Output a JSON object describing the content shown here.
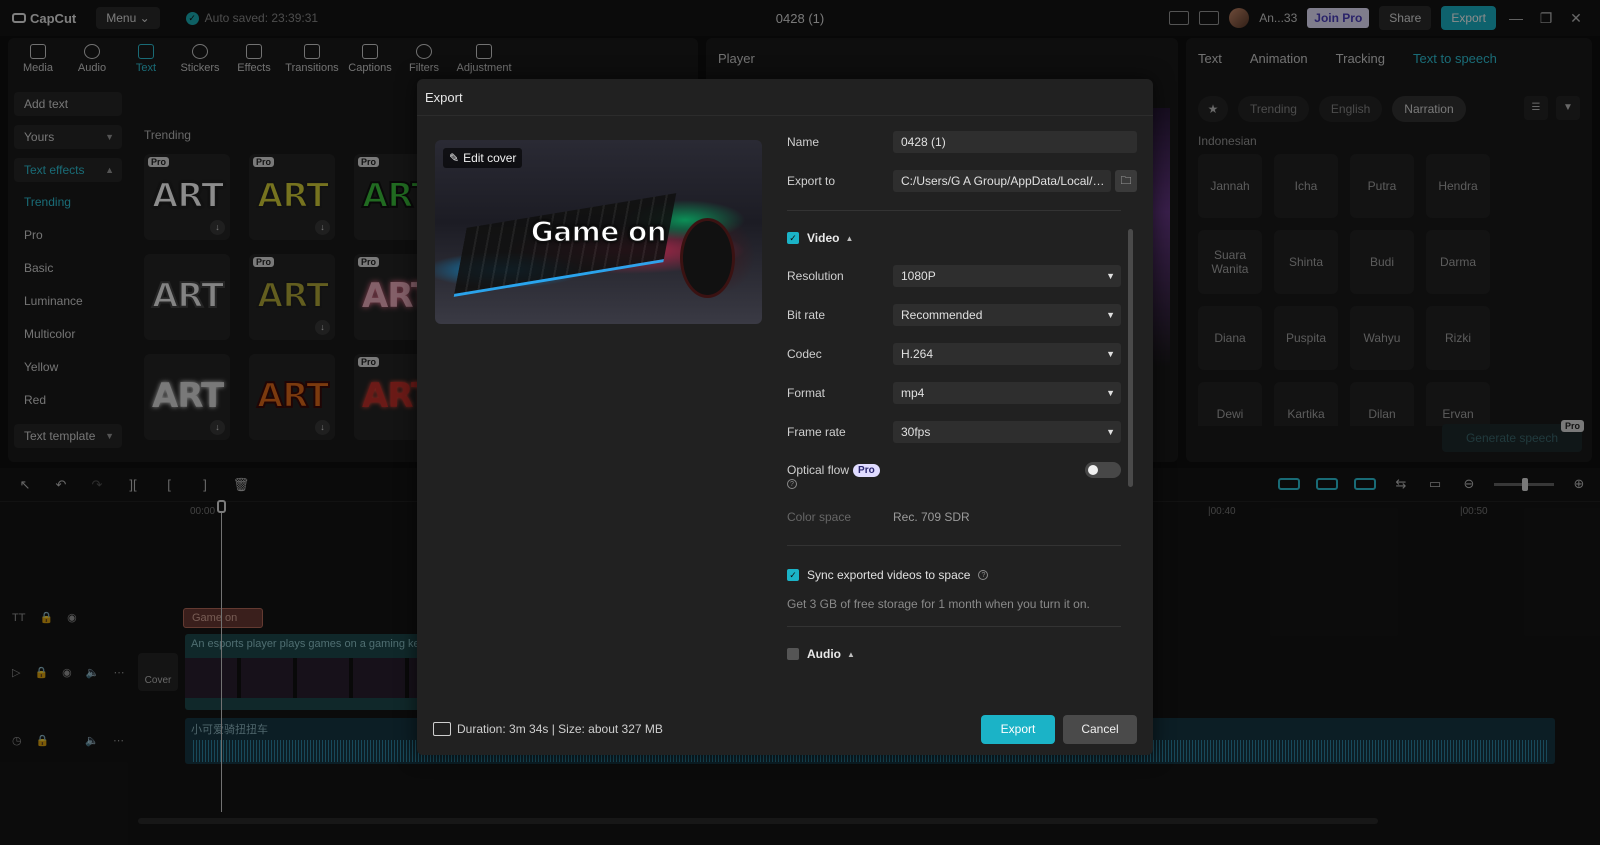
{
  "app": {
    "logo": "CapCut",
    "menu_label": "Menu",
    "autosave": "Auto saved: 23:39:31",
    "doc_title": "0428 (1)",
    "user_name": "An...33",
    "join_pro": "Join Pro",
    "share": "Share",
    "export": "Export"
  },
  "left_panel": {
    "tabs": [
      {
        "label": "Media"
      },
      {
        "label": "Audio"
      },
      {
        "label": "Text"
      },
      {
        "label": "Stickers"
      },
      {
        "label": "Effects"
      },
      {
        "label": "Transitions"
      },
      {
        "label": "Captions"
      },
      {
        "label": "Filters"
      },
      {
        "label": "Adjustment"
      }
    ],
    "nav": {
      "add_text": "Add text",
      "yours": "Yours",
      "text_effects": "Text effects",
      "items": [
        "Trending",
        "Pro",
        "Basic",
        "Luminance",
        "Multicolor",
        "Yellow",
        "Red"
      ],
      "text_template": "Text template"
    },
    "section_label": "Trending",
    "art_label": "ART",
    "pro_label": "Pro"
  },
  "player": {
    "title": "Player"
  },
  "right_panel": {
    "tabs": [
      "Text",
      "Animation",
      "Tracking",
      "Text to speech"
    ],
    "filters": [
      "Trending",
      "English",
      "Narration"
    ],
    "language": "Indonesian",
    "voices": [
      "Jannah",
      "Icha",
      "Putra",
      "Hendra",
      "Suara Wanita",
      "Shinta",
      "Budi",
      "Darma",
      "Diana",
      "Puspita",
      "Wahyu",
      "Rizki",
      "Dewi",
      "Kartika",
      "Dilan",
      "Ervan"
    ],
    "generate": "Generate speech",
    "pro_label": "Pro"
  },
  "timeline": {
    "ruler": [
      "00:00",
      "|00:40",
      "|00:50"
    ],
    "text_clip": "Game on",
    "video_clip": "An esports player plays games on a gaming keyboard",
    "audio_clip": "小可爱骑扭扭车",
    "cover_label": "Cover"
  },
  "export_dialog": {
    "title": "Export",
    "edit_cover": "Edit cover",
    "cover_text": "Game on",
    "name_label": "Name",
    "name_value": "0428 (1)",
    "export_to_label": "Export to",
    "export_to_value": "C:/Users/G A Group/AppData/Local/C...",
    "video_section": "Video",
    "resolution_label": "Resolution",
    "resolution_value": "1080P",
    "bitrate_label": "Bit rate",
    "bitrate_value": "Recommended",
    "codec_label": "Codec",
    "codec_value": "H.264",
    "format_label": "Format",
    "format_value": "mp4",
    "framerate_label": "Frame rate",
    "framerate_value": "30fps",
    "optical_flow_label": "Optical flow",
    "pro_badge": "Pro",
    "colorspace_label": "Color space",
    "colorspace_value": "Rec. 709 SDR",
    "sync_label": "Sync exported videos to space",
    "sync_hint": "Get 3 GB of free storage for 1 month when you turn it on.",
    "audio_section": "Audio",
    "footer": "Duration: 3m 34s | Size: about 327 MB",
    "export_button": "Export",
    "cancel_button": "Cancel"
  },
  "colors": {
    "accent": "#1bb3c7",
    "pro_badge": "#e0dcff"
  }
}
